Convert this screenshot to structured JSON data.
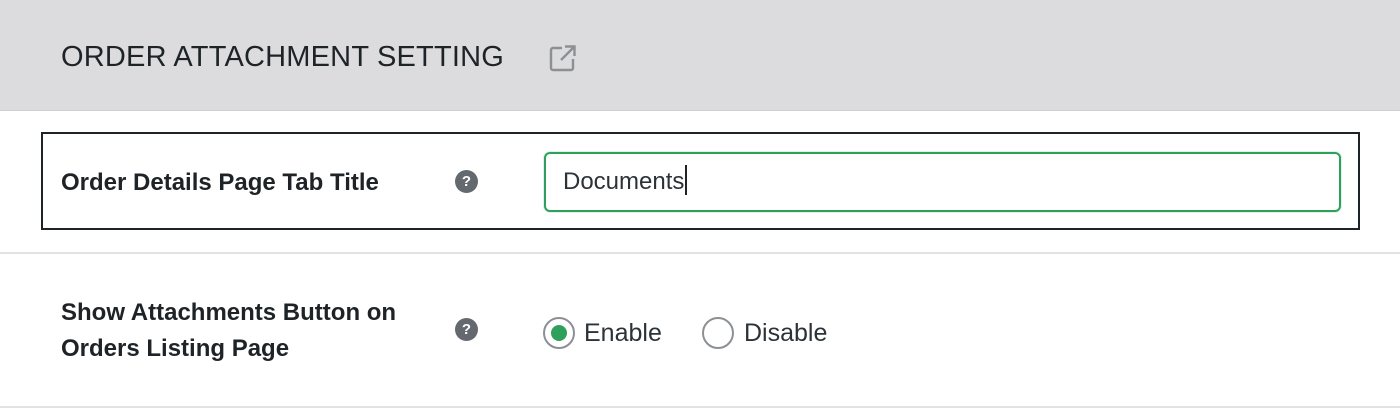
{
  "header": {
    "title": "ORDER ATTACHMENT SETTING",
    "external_link_icon": "external-link-icon"
  },
  "settings": {
    "tab_title": {
      "label": "Order Details Page Tab Title",
      "help_icon": "question-mark-icon",
      "value": "Documents"
    },
    "attachments_button": {
      "label_line1": "Show Attachments Button on",
      "label_line2": "Orders Listing Page",
      "help_icon": "question-mark-icon",
      "options": [
        {
          "label": "Enable",
          "selected": true
        },
        {
          "label": "Disable",
          "selected": false
        }
      ],
      "help_glyph": "?"
    }
  },
  "colors": {
    "accent": "#2ea05c",
    "header_bg": "#dcdcde",
    "text": "#1d2327"
  }
}
